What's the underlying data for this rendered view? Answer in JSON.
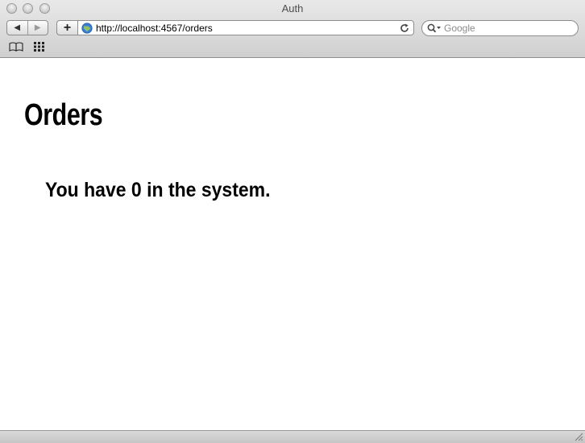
{
  "window": {
    "title": "Auth"
  },
  "toolbar": {
    "back_icon": "back-arrow-icon",
    "forward_icon": "forward-arrow-icon",
    "add_label": "+",
    "url": "http://localhost:4567/orders",
    "search_placeholder": "Google"
  },
  "page": {
    "heading": "Orders",
    "summary": "You have 0 in the system."
  },
  "colors": {
    "chrome": "#d6d6d6",
    "content_bg": "#ffffff",
    "text": "#000000"
  }
}
